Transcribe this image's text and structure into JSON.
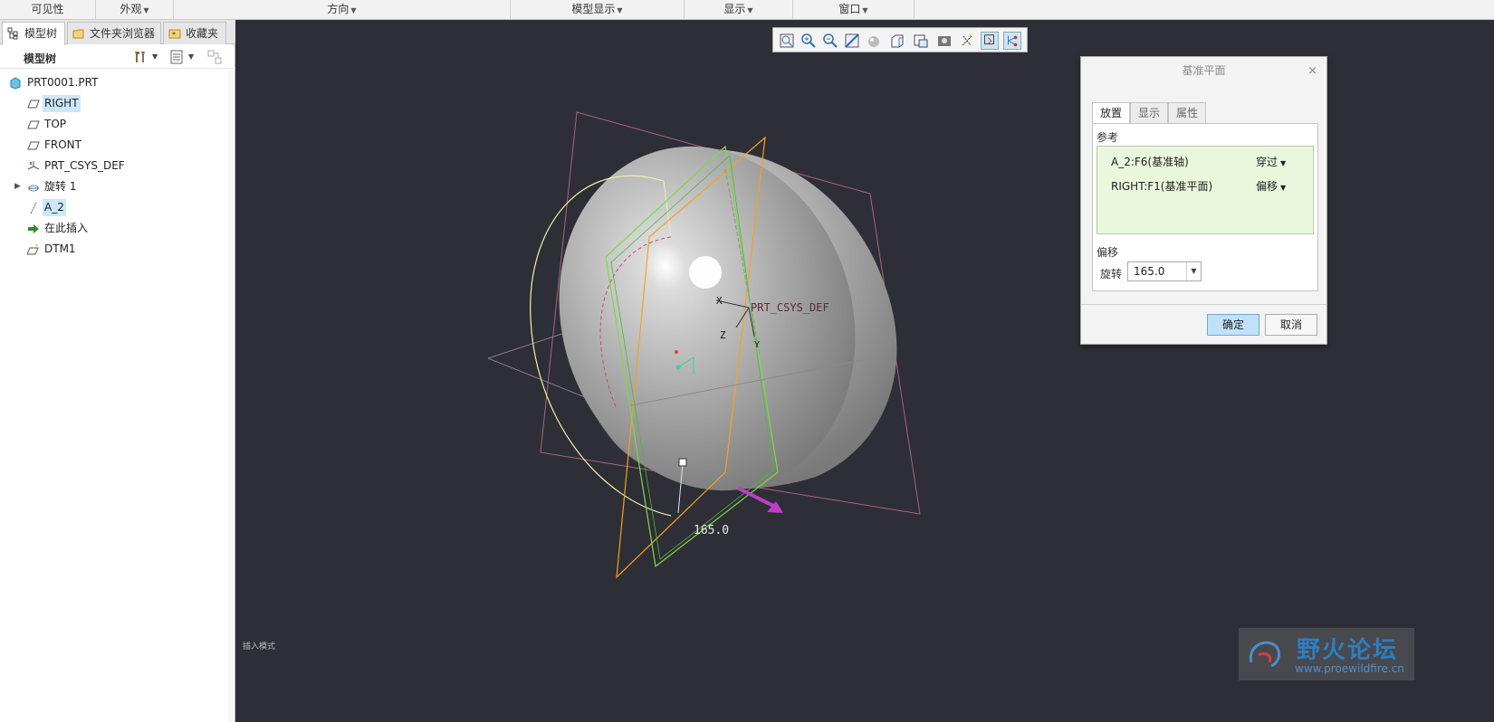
{
  "ribbon": {
    "groups": [
      {
        "label": "可见性",
        "has_menu": false
      },
      {
        "label": "外观",
        "has_menu": true
      },
      {
        "label": "方向",
        "has_menu": true
      },
      {
        "label": "模型显示",
        "has_menu": true
      },
      {
        "label": "显示",
        "has_menu": true
      },
      {
        "label": "窗口",
        "has_menu": true
      }
    ]
  },
  "left_panel": {
    "tabs": [
      "模型树",
      "文件夹浏览器",
      "收藏夹"
    ],
    "header_title": "模型树",
    "tree": [
      {
        "label": "PRT0001.PRT",
        "icon": "part-icon",
        "selected": false
      },
      {
        "label": "RIGHT",
        "icon": "datum-plane-icon",
        "selected": true
      },
      {
        "label": "TOP",
        "icon": "datum-plane-icon",
        "selected": false
      },
      {
        "label": "FRONT",
        "icon": "datum-plane-icon",
        "selected": false
      },
      {
        "label": "PRT_CSYS_DEF",
        "icon": "csys-icon",
        "selected": false
      },
      {
        "label": "旋转 1",
        "icon": "revolve-icon",
        "selected": false
      },
      {
        "label": "A_2",
        "icon": "datum-axis-icon",
        "selected": true
      },
      {
        "label": "在此插入",
        "icon": "insert-arrow-icon",
        "selected": false
      },
      {
        "label": "DTM1",
        "icon": "datum-plane-new-icon",
        "selected": false
      }
    ]
  },
  "viewport": {
    "labels": {
      "csys": "PRT_CSYS_DEF",
      "x": "X",
      "y": "Y",
      "z": "Z",
      "dimension": "165.0"
    },
    "status_hint": "插入模式",
    "toolbar_icons": [
      "refit-icon",
      "zoom-in-icon",
      "zoom-out-icon",
      "repaint-icon",
      "display-style-icon",
      "saved-orientations-icon",
      "view-manager-icon",
      "perspective-icon",
      "datum-display-icon",
      "spin-center-icon",
      "annotation-display-icon"
    ]
  },
  "dialog": {
    "title": "基准平面",
    "close": "×",
    "tabs": [
      "放置",
      "显示",
      "属性"
    ],
    "references_label": "参考",
    "references": [
      {
        "name": "A_2:F6(基准轴)",
        "constraint": "穿过"
      },
      {
        "name": "RIGHT:F1(基准平面)",
        "constraint": "偏移"
      }
    ],
    "offset_label": "偏移",
    "rotation_label": "旋转",
    "rotation_value": "165.0",
    "ok_label": "确定",
    "cancel_label": "取消"
  },
  "watermark": {
    "title": "野火论坛",
    "url": "www.proewildfire.cn"
  },
  "colors": {
    "viewport_bg": "#2e2e36",
    "selection_bg": "#cce8f8",
    "ref_bg": "#eaf7dc",
    "ok_button": "#bfe2f8",
    "preview_plane": "#f2a321",
    "selected_plane": "#7ed84a",
    "datum_plane": "#9c6b7a",
    "dimension_arc": "#f2f0a8"
  }
}
